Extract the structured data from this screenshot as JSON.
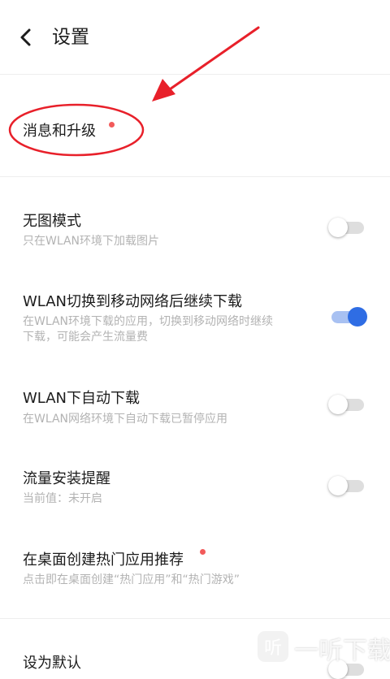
{
  "header": {
    "title": "设置"
  },
  "items": {
    "messages": {
      "title": "消息和升级"
    },
    "no_image": {
      "title": "无图模式",
      "subtitle": "只在WLAN环境下加载图片",
      "enabled": false
    },
    "wlan_switch": {
      "title": "WLAN切换到移动网络后继续下载",
      "subtitle_line1": "在WLAN环境下载的应用，切换到移动网络时继续",
      "subtitle_line2": "下载，可能会产生流量费",
      "enabled": true
    },
    "wlan_auto": {
      "title": "WLAN下自动下载",
      "subtitle": "在WLAN网络环境下自动下载已暂停应用",
      "enabled": false
    },
    "traffic_alert": {
      "title": "流量安装提醒",
      "subtitle": "当前值：未开启",
      "enabled": false
    },
    "hot_apps": {
      "title": "在桌面创建热门应用推荐",
      "subtitle": "点击即在桌面创建“热门应用”和“热门游戏”"
    },
    "default": {
      "title": "设为默认",
      "enabled": false
    }
  },
  "watermark": {
    "text": "一听下载"
  },
  "colors": {
    "accent": "#2f6de4",
    "badge": "#f25a5a",
    "annotation": "#e8202a"
  }
}
